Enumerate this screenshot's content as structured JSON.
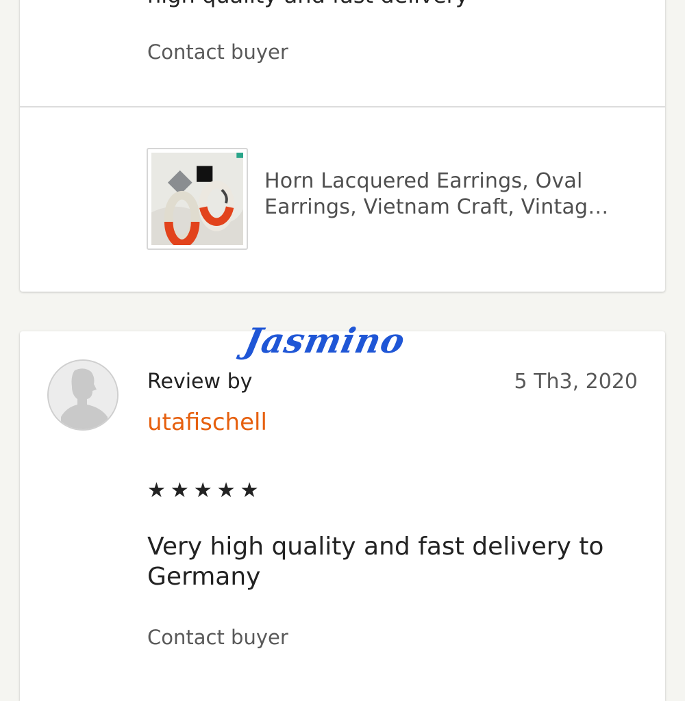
{
  "previous_review": {
    "partial_text": "high quality and fast delivery",
    "contact_label": "Contact buyer",
    "listing": {
      "title": "Horn Lacquered Earrings, Oval Earrings, Vietnam Craft, Vintag…"
    }
  },
  "review": {
    "review_by_label": "Review by",
    "reviewer_name": "utafischell",
    "date": "5 Th3, 2020",
    "rating": 5,
    "stars": "★★★★★",
    "text": "Very high quality and fast delivery to Germany",
    "contact_label": "Contact buyer"
  },
  "watermark": {
    "text": "Jasmino"
  },
  "colors": {
    "background": "#f5f5f1",
    "card": "#ffffff",
    "reviewer_name": "#e6600f",
    "watermark": "#1f56d6"
  },
  "icons": {
    "avatar": "default-user-avatar-icon",
    "star": "star-icon"
  }
}
